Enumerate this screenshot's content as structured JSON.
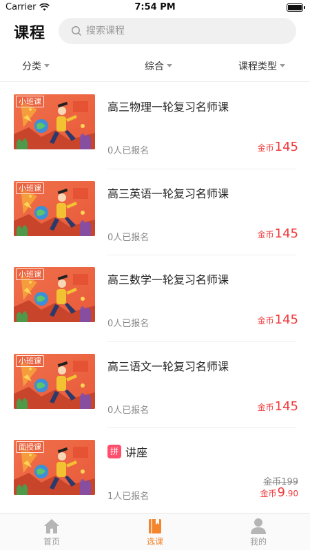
{
  "status_bar": {
    "carrier": "Carrier",
    "time": "7:54 PM"
  },
  "header": {
    "title": "课程",
    "search_placeholder": "搜索课程"
  },
  "filters": [
    {
      "label": "分类"
    },
    {
      "label": "综合"
    },
    {
      "label": "课程类型"
    }
  ],
  "courses": [
    {
      "badge": "小班课",
      "title": "高三物理一轮复习名师课",
      "enrolled": "0人已报名",
      "price_unit": "金币",
      "price": "145"
    },
    {
      "badge": "小班课",
      "title": "高三英语一轮复习名师课",
      "enrolled": "0人已报名",
      "price_unit": "金币",
      "price": "145"
    },
    {
      "badge": "小班课",
      "title": "高三数学一轮复习名师课",
      "enrolled": "0人已报名",
      "price_unit": "金币",
      "price": "145"
    },
    {
      "badge": "小班课",
      "title": "高三语文一轮复习名师课",
      "enrolled": "0人已报名",
      "price_unit": "金币",
      "price": "145"
    },
    {
      "badge": "面授课",
      "tag": "拼",
      "title": "讲座",
      "enrolled": "1人已报名",
      "original_price": "金币199",
      "price_unit": "金币",
      "price_int": "9",
      "price_dec": ".90"
    }
  ],
  "tabs": [
    {
      "label": "首页",
      "icon": "home-icon"
    },
    {
      "label": "选课",
      "icon": "book-icon",
      "active": true
    },
    {
      "label": "我的",
      "icon": "person-icon"
    }
  ],
  "colors": {
    "accent": "#f4852f",
    "price": "#f0383a",
    "pin_badge": "#ff4f6d"
  }
}
